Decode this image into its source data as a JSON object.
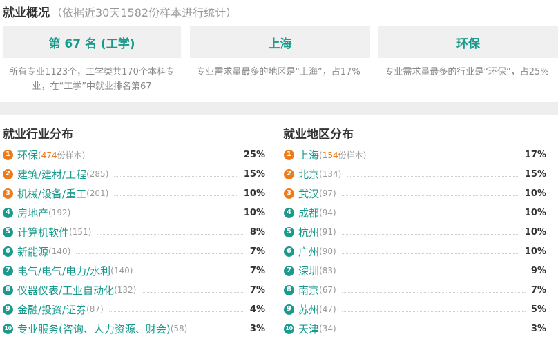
{
  "overview": {
    "title": "就业概况",
    "subtitle": "（依据近30天1582份样本进行统计）"
  },
  "cards": [
    {
      "label": "第 67 名 (工学)",
      "desc": "所有专业1123个，工学类共170个本科专业，在“工学”中就业排名第67"
    },
    {
      "label": "上海",
      "desc": "专业需求量最多的地区是“上海”，占17%"
    },
    {
      "label": "环保",
      "desc": "专业需求量最多的行业是“环保”，占25%"
    }
  ],
  "industry": {
    "title": "就业行业分布",
    "items": [
      {
        "rank": "1",
        "name": "环保",
        "count_pre": "(",
        "count_num": "474",
        "count_post": "份样本)",
        "pct": "25%"
      },
      {
        "rank": "2",
        "name": "建筑/建材/工程",
        "count": "(285)",
        "pct": "15%"
      },
      {
        "rank": "3",
        "name": "机械/设备/重工",
        "count": "(201)",
        "pct": "10%"
      },
      {
        "rank": "4",
        "name": "房地产",
        "count": "(192)",
        "pct": "10%"
      },
      {
        "rank": "5",
        "name": "计算机软件",
        "count": "(151)",
        "pct": "8%"
      },
      {
        "rank": "6",
        "name": "新能源",
        "count": "(140)",
        "pct": "7%"
      },
      {
        "rank": "7",
        "name": "电气/电气/电力/水利",
        "count": "(140)",
        "pct": "7%"
      },
      {
        "rank": "8",
        "name": "仪器仪表/工业自动化",
        "count": "(132)",
        "pct": "7%"
      },
      {
        "rank": "9",
        "name": "金融/投资/证券",
        "count": "(87)",
        "pct": "4%"
      },
      {
        "rank": "10",
        "name": "专业服务(咨询、人力资源、财会)",
        "count": "(58)",
        "pct": "3%"
      }
    ]
  },
  "region": {
    "title": "就业地区分布",
    "items": [
      {
        "rank": "1",
        "name": "上海",
        "count_pre": "(",
        "count_num": "154",
        "count_post": "份样本)",
        "pct": "17%"
      },
      {
        "rank": "2",
        "name": "北京",
        "count": "(134)",
        "pct": "15%"
      },
      {
        "rank": "3",
        "name": "武汉",
        "count": "(97)",
        "pct": "10%"
      },
      {
        "rank": "4",
        "name": "成都",
        "count": "(94)",
        "pct": "10%"
      },
      {
        "rank": "5",
        "name": "杭州",
        "count": "(91)",
        "pct": "10%"
      },
      {
        "rank": "6",
        "name": "广州",
        "count": "(90)",
        "pct": "10%"
      },
      {
        "rank": "7",
        "name": "深圳",
        "count": "(83)",
        "pct": "9%"
      },
      {
        "rank": "8",
        "name": "南京",
        "count": "(67)",
        "pct": "7%"
      },
      {
        "rank": "9",
        "name": "苏州",
        "count": "(47)",
        "pct": "5%"
      },
      {
        "rank": "10",
        "name": "天津",
        "count": "(34)",
        "pct": "3%"
      }
    ]
  },
  "colors": {
    "teal": "#1a9a8d",
    "orange": "#f07a17"
  }
}
